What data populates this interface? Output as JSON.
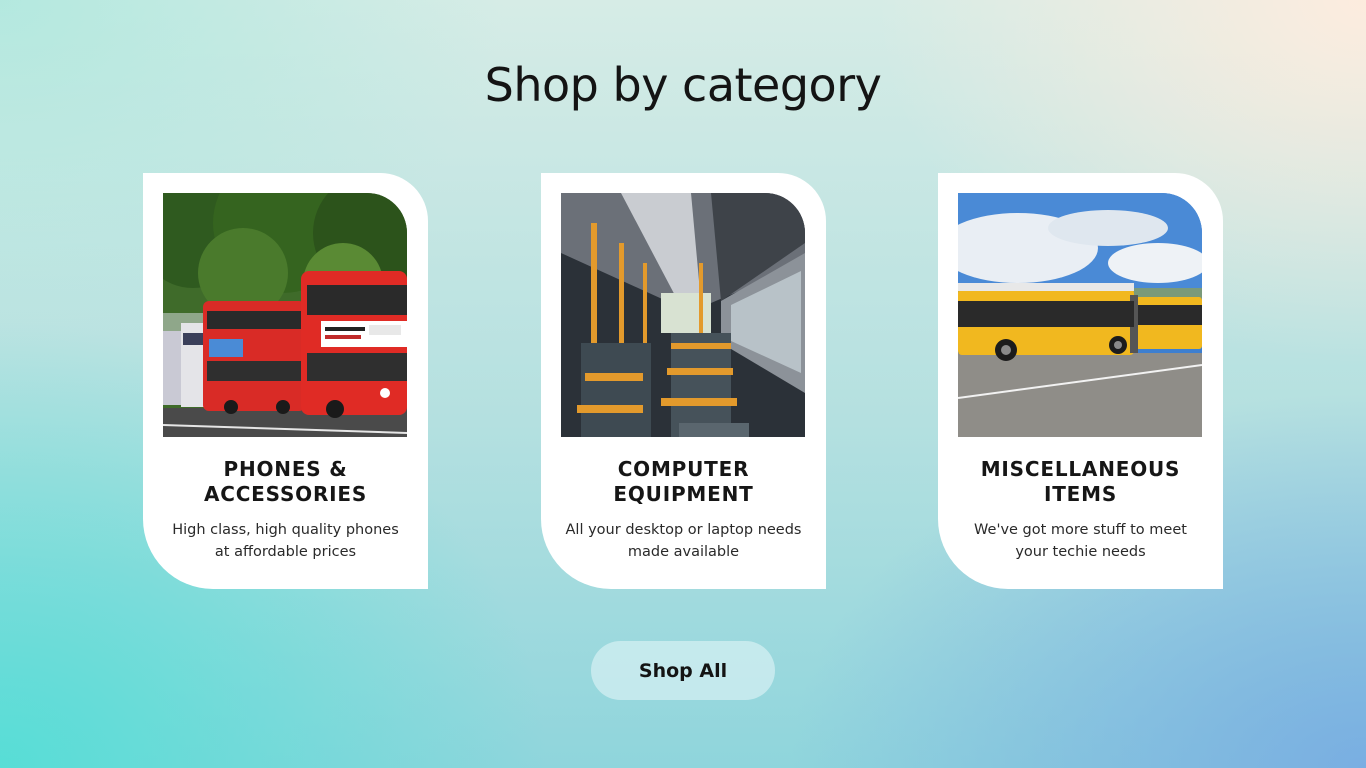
{
  "section": {
    "title": "Shop by category"
  },
  "categories": [
    {
      "title": "PHONES &\nACCESSORIES",
      "description": "High class, high quality phones\nat affordable prices",
      "image": "red-double-decker-buses-photo"
    },
    {
      "title": "COMPUTER\nEQUIPMENT",
      "description": "All your desktop or laptop needs\nmade available",
      "image": "bus-interior-seats-photo"
    },
    {
      "title": "MISCELLANEOUS\nITEMS",
      "description": "We've got more stuff to meet\nyour techie needs",
      "image": "yellow-articulated-bus-photo"
    }
  ],
  "actions": {
    "shop_all_label": "Shop All"
  },
  "colors": {
    "card_background": "#ffffff",
    "button_background": "#d6f0f2",
    "text": "#141414"
  }
}
